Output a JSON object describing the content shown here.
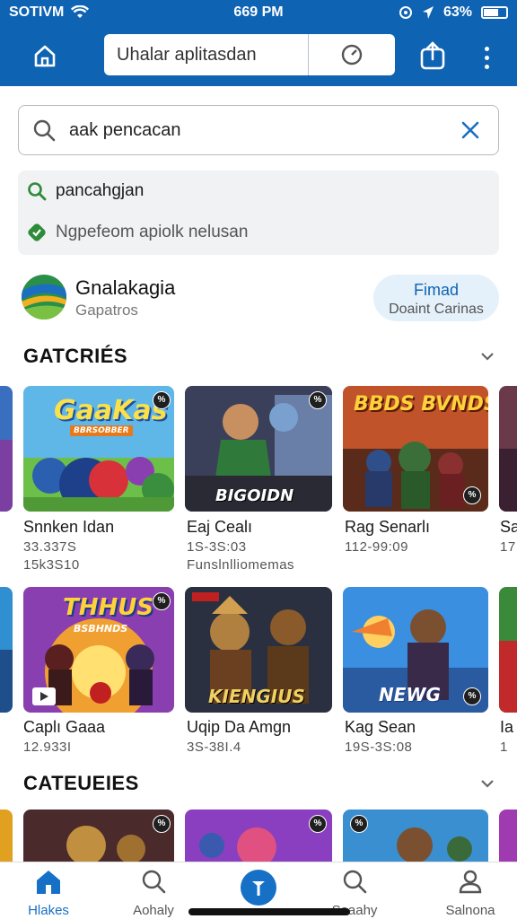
{
  "status_bar": {
    "carrier": "SOTIVM",
    "time": "669 PM",
    "battery": "63%"
  },
  "toolbar": {
    "url_text": "Uhalar aplitasdan"
  },
  "search": {
    "query": "aak pencacan"
  },
  "suggestions": [
    {
      "label": "pancahgjan",
      "icon": "search-icon"
    },
    {
      "label": "Ngpefeom apiolk nelusan",
      "icon": "check-tag-icon"
    }
  ],
  "featured_app": {
    "name": "Gnalakagia",
    "subtitle": "Gapatros",
    "button_label": "Fimad",
    "button_sub": "Doaint Carinas"
  },
  "sections": [
    {
      "title": "GATCRIÉS"
    },
    {
      "title": "CATEUEIES"
    }
  ],
  "row1": [
    {
      "title": "Snnken Idan",
      "meta1": "33.337S",
      "meta2": "15k3S10",
      "art_text": "GaaKas",
      "art_sub": "BBRSOBBER"
    },
    {
      "title": "Eaj Cealı",
      "meta1": "1S-3S:03",
      "meta2": "Funslnlliomemas",
      "art_text": "BIGOIDN"
    },
    {
      "title": "Rag Senarlı",
      "meta1": "112-99:09",
      "meta2": "",
      "art_text": "BBDS BVNDS"
    },
    {
      "title": "Sa",
      "meta1": "17",
      "meta2": ""
    }
  ],
  "row2": [
    {
      "title": "Caplı Gaaa",
      "meta1": "12.933I",
      "art_text": "THHUS",
      "art_sub": "BSBHNDS"
    },
    {
      "title": "Uqip Da Amgn",
      "meta1": "3S-38I.4",
      "art_text": "KIENGIUS"
    },
    {
      "title": "Kag Sean",
      "meta1": "19S-3S:08",
      "art_text": "NEWG"
    },
    {
      "title": "Ia",
      "meta1": "1"
    }
  ],
  "bottom_nav": [
    {
      "label": "Hlakes",
      "icon": "home-icon",
      "active": true
    },
    {
      "label": "Aohaly",
      "icon": "search-icon"
    },
    {
      "label": "",
      "icon": "compass-pin-icon"
    },
    {
      "label": "Saaahy",
      "icon": "search-icon"
    },
    {
      "label": "Salnona",
      "icon": "person-icon"
    }
  ],
  "colors": {
    "brand_blue": "#0f63b3",
    "active_tab": "#1670c5",
    "search_green": "#2e8b3a"
  }
}
